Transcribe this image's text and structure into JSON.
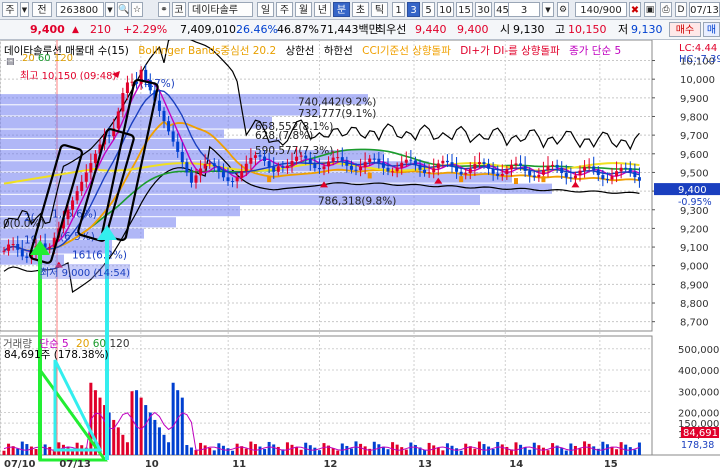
{
  "toolbar": {
    "mode": "주",
    "prev_label": "전",
    "code": "263800",
    "market_tag": "코",
    "name": "데이타솔루",
    "periods": [
      "일",
      "주",
      "월",
      "년",
      "분",
      "초",
      "틱"
    ],
    "selected_period": "분",
    "minutes": [
      "1",
      "3",
      "5",
      "10",
      "15",
      "30",
      "45",
      "60"
    ],
    "selected_minute": "3",
    "period_value": "3",
    "count": "140/900",
    "date": "07/13",
    "d_label": "D"
  },
  "quote": {
    "price": "9,400",
    "change": "210",
    "change_rate": "+2.29%",
    "volume": "7,409,010",
    "rate1": "26.46%",
    "rate2": "46.87%",
    "amount": "71,443백만",
    "best_label": "최우선",
    "best_ask": "9,440",
    "best_bid": "9,400",
    "open_label": "시",
    "open": "9,130",
    "high_label": "고",
    "high": "10,150",
    "low_label": "저",
    "low": "9,130",
    "buy_label": "매수",
    "sell_label": "매"
  },
  "legend": {
    "name": "데이타솔루션 매물대 수(15)",
    "bollinger": "Bollinger Bands중심선 20.2",
    "upper": "상한선",
    "lower": "하한선",
    "cci": "CCI기준선 상향돌파",
    "dmi": "DI+가 DI-를 상향돌파",
    "close_ma": "종가 단순 5",
    "ma_nums": [
      "20",
      "60",
      "120"
    ],
    "high_marker": "최고 10,150 (09:48)",
    "low_marker": "최저 9,000 (14:54)",
    "right_top1": "LC:4.44",
    "right_top2": "HC:-7.39"
  },
  "volume_legend": {
    "title": "거래량",
    "ma": "단순 5",
    "nums": [
      "20",
      "60",
      "120"
    ],
    "value": "84,691주 (178.38%)"
  },
  "colors": {
    "up": "#e0002a",
    "down": "#0040d0",
    "upper_band": "#000000",
    "mid_band": "#1a9b2c",
    "cci": "#f0a000",
    "vol_bands": "#7a82f0",
    "ma5": "#c000c0",
    "arrow_green": "#22ee33",
    "arrow_cyan": "#33eeee"
  },
  "chart_data": {
    "type": "candlestick",
    "price_axis": [
      "10,100",
      "10,000",
      "9,900",
      "9,800",
      "9,700",
      "9,600",
      "9,500",
      "9,400",
      "9,300",
      "9,200",
      "9,100",
      "9,000",
      "8,900",
      "8,800",
      "8,700"
    ],
    "price_ylim": [
      8650,
      10210
    ],
    "current_price": "9,400",
    "current_rate": "-0.95%",
    "volume_axis": [
      "500,000",
      "400,000",
      "300,000",
      "200,000",
      "150,000",
      "100,000"
    ],
    "volume_current": "84,691",
    "volume_ref": "178,38",
    "x_ticks": [
      {
        "label": "07/10",
        "pos": 0.0
      },
      {
        "label": "07/13",
        "pos": 0.085
      },
      {
        "label": "10",
        "pos": 0.216
      },
      {
        "label": "11",
        "pos": 0.35
      },
      {
        "label": "12",
        "pos": 0.49
      },
      {
        "label": "13",
        "pos": 0.635
      },
      {
        "label": "14",
        "pos": 0.775
      },
      {
        "label": "15",
        "pos": 0.92
      }
    ],
    "profile_labels": [
      {
        "text": "740,442(9.2%)",
        "price": 9880
      },
      {
        "text": "732,777(9.1%)",
        "price": 9820
      },
      {
        "text": "658,552(8.1%)",
        "price": 9750
      },
      {
        "text": "628,(7.8%)",
        "price": 9700
      },
      {
        "text": "590,577(7.3%)",
        "price": 9620
      },
      {
        "text": "786,318(9.8%)",
        "price": 9350
      },
      {
        "text": "0(0.0%)",
        "price": 9230
      }
    ],
    "price_labels": [
      {
        "text": "(4.7%)",
        "price": 9980
      },
      {
        "text": "1,(5.6%)",
        "price": 9280
      },
      {
        "text": "(6.5%)",
        "price": 9160
      },
      {
        "text": "161(6.2%)",
        "price": 9060
      }
    ],
    "left_labels": [
      {
        "text": "2(",
        "price": 9260
      },
      {
        "text": "19",
        "price": 9140
      }
    ]
  }
}
